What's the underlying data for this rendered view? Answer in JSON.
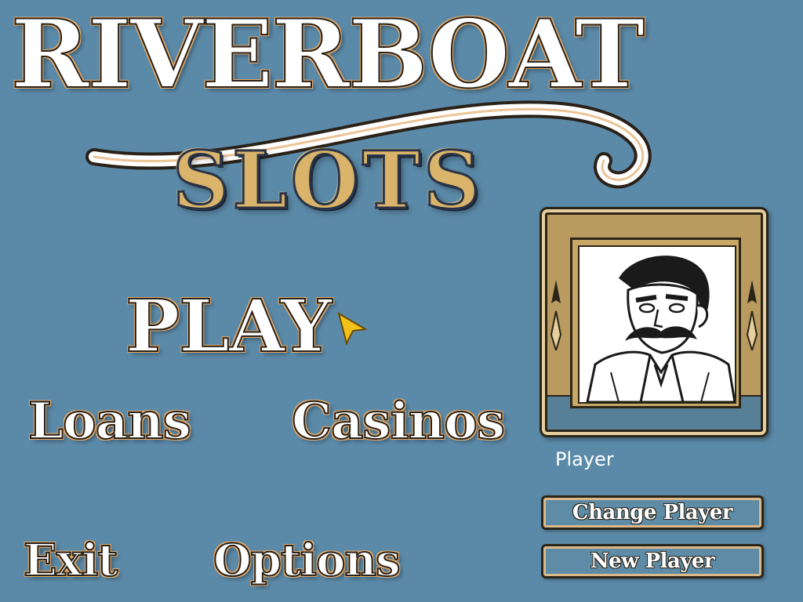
{
  "logo": {
    "title": "RIVERBOAT",
    "subtitle": "SLOTS"
  },
  "menu": {
    "play": "PLAY",
    "loans": "Loans",
    "casinos": "Casinos",
    "exit": "Exit",
    "options": "Options"
  },
  "player": {
    "name": "Player",
    "change_label": "Change Player",
    "new_label": "New Player"
  },
  "colors": {
    "background": "#5b8aa8",
    "gold": "#c8a867",
    "plate": "#5e8ba6"
  }
}
